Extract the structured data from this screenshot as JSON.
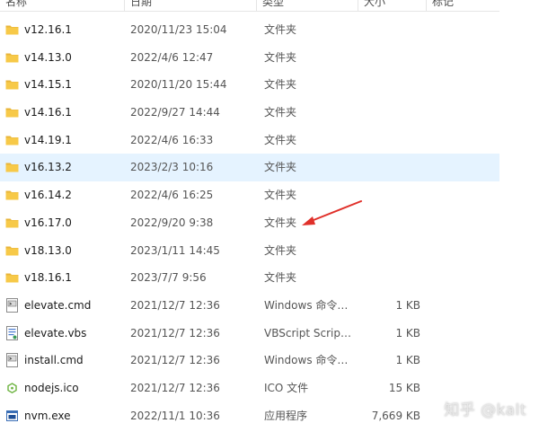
{
  "columns": {
    "name": "名称",
    "date": "日期",
    "type": "类型",
    "size": "大小",
    "tags": "标记"
  },
  "rows": [
    {
      "name": "v12.16.1",
      "date": "2020/11/23 15:04",
      "type": "文件夹",
      "size": "",
      "icon": "folder-icon"
    },
    {
      "name": "v14.13.0",
      "date": "2022/4/6 12:47",
      "type": "文件夹",
      "size": "",
      "icon": "folder-icon"
    },
    {
      "name": "v14.15.1",
      "date": "2020/11/20 15:44",
      "type": "文件夹",
      "size": "",
      "icon": "folder-icon"
    },
    {
      "name": "v14.16.1",
      "date": "2022/9/27 14:44",
      "type": "文件夹",
      "size": "",
      "icon": "folder-icon"
    },
    {
      "name": "v14.19.1",
      "date": "2022/4/6 16:33",
      "type": "文件夹",
      "size": "",
      "icon": "folder-icon"
    },
    {
      "name": "v16.13.2",
      "date": "2023/2/3 10:16",
      "type": "文件夹",
      "size": "",
      "icon": "folder-icon",
      "selected": true
    },
    {
      "name": "v16.14.2",
      "date": "2022/4/6 16:25",
      "type": "文件夹",
      "size": "",
      "icon": "folder-icon"
    },
    {
      "name": "v16.17.0",
      "date": "2022/9/20 9:38",
      "type": "文件夹",
      "size": "",
      "icon": "folder-icon"
    },
    {
      "name": "v18.13.0",
      "date": "2023/1/11 14:45",
      "type": "文件夹",
      "size": "",
      "icon": "folder-icon"
    },
    {
      "name": "v18.16.1",
      "date": "2023/7/7 9:56",
      "type": "文件夹",
      "size": "",
      "icon": "folder-icon"
    },
    {
      "name": "elevate.cmd",
      "date": "2021/12/7 12:36",
      "type": "Windows 命令脚本",
      "size": "1 KB",
      "icon": "cmd-file-icon"
    },
    {
      "name": "elevate.vbs",
      "date": "2021/12/7 12:36",
      "type": "VBScript Script ...",
      "size": "1 KB",
      "icon": "vbs-file-icon"
    },
    {
      "name": "install.cmd",
      "date": "2021/12/7 12:36",
      "type": "Windows 命令脚本",
      "size": "1 KB",
      "icon": "cmd-file-icon"
    },
    {
      "name": "nodejs.ico",
      "date": "2021/12/7 12:36",
      "type": "ICO 文件",
      "size": "15 KB",
      "icon": "ico-file-icon"
    },
    {
      "name": "nvm.exe",
      "date": "2022/11/1 10:36",
      "type": "应用程序",
      "size": "7,669 KB",
      "icon": "exe-file-icon"
    }
  ],
  "annotation": {
    "icon": "red-arrow-icon",
    "color": "#e0302a"
  },
  "watermark": "知乎 @kalt",
  "colors": {
    "selected_row": "#e5f3ff",
    "folder": "#f7c948"
  }
}
